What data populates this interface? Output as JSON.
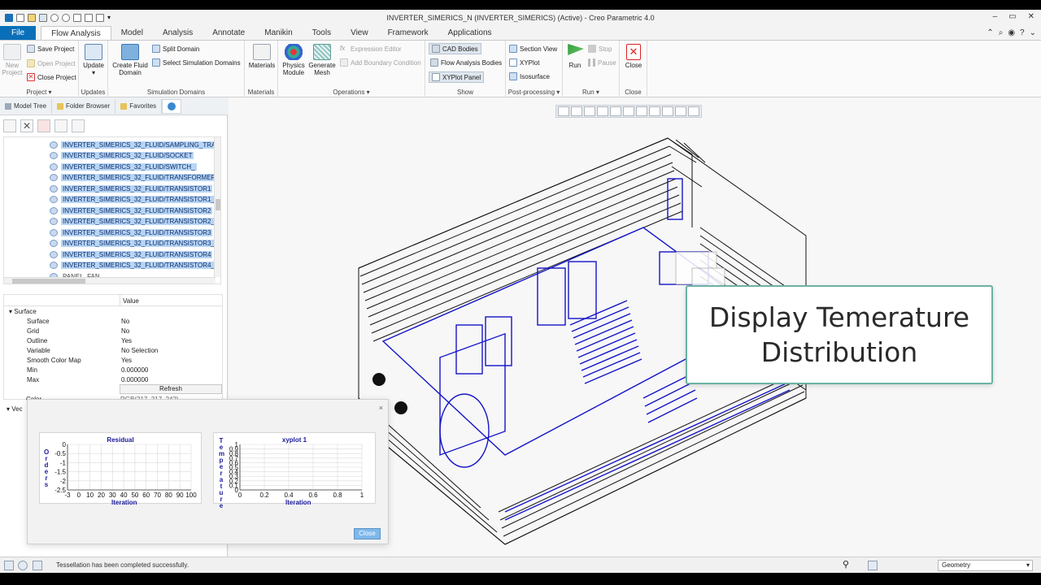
{
  "window": {
    "title": "INVERTER_SIMERICS_N (INVERTER_SIMERICS) (Active) - Creo Parametric 4.0",
    "controls": [
      "–",
      "▭",
      "✕"
    ]
  },
  "ribbon_tabs": [
    {
      "label": "File"
    },
    {
      "label": "Flow Analysis"
    },
    {
      "label": "Model"
    },
    {
      "label": "Analysis"
    },
    {
      "label": "Annotate"
    },
    {
      "label": "Manikin"
    },
    {
      "label": "Tools"
    },
    {
      "label": "View"
    },
    {
      "label": "Framework"
    },
    {
      "label": "Applications"
    }
  ],
  "ribbon": {
    "project": {
      "group_label": "Project ▾",
      "new_project": "New\nProject",
      "save_project": "Save Project",
      "open_project": "Open Project",
      "close_project": "Close Project"
    },
    "updates": {
      "group_label": "Updates",
      "update": "Update ▾"
    },
    "simulation_domains": {
      "group_label": "Simulation Domains",
      "create_fluid_domain": "Create Fluid\nDomain",
      "split_domain": "Split Domain",
      "select_simulation_domains": "Select Simulation Domains"
    },
    "materials": {
      "group_label": "Materials",
      "materials": "Materials"
    },
    "operations": {
      "group_label": "Operations ▾",
      "physics_module": "Physics\nModule",
      "generate_mesh": "Generate\nMesh",
      "expression_editor": "Expression Editor",
      "add_boundary_condition": "Add Boundary Condition"
    },
    "show": {
      "group_label": "Show",
      "cad_bodies": "CAD Bodies",
      "flow_analysis_bodies": "Flow Analysis Bodies",
      "xyplot_panel": "XYPlot Panel"
    },
    "post_processing": {
      "group_label": "Post-processing ▾",
      "section_view": "Section View",
      "xyplot": "XYPlot",
      "isosurface": "Isosurface"
    },
    "run": {
      "group_label": "Run ▾",
      "run": "Run",
      "stop": "Stop",
      "pause": "Pause"
    },
    "close": {
      "group_label": "Close",
      "close": "Close"
    }
  },
  "nav_tabs": [
    {
      "label": "Model Tree"
    },
    {
      "label": "Folder Browser"
    },
    {
      "label": "Favorites"
    }
  ],
  "tree_items": [
    {
      "label": "INVERTER_SIMERICS_32_FLUID/SAMPLING_TRANSFO",
      "selected": true
    },
    {
      "label": "INVERTER_SIMERICS_32_FLUID/SOCKET",
      "selected": true
    },
    {
      "label": "INVERTER_SIMERICS_32_FLUID/SWITCH_",
      "selected": true
    },
    {
      "label": "INVERTER_SIMERICS_32_FLUID/TRANSFORMER",
      "selected": true
    },
    {
      "label": "INVERTER_SIMERICS_32_FLUID/TRANSISTOR1",
      "selected": true
    },
    {
      "label": "INVERTER_SIMERICS_32_FLUID/TRANSISTOR1_1",
      "selected": true
    },
    {
      "label": "INVERTER_SIMERICS_32_FLUID/TRANSISTOR2",
      "selected": true
    },
    {
      "label": "INVERTER_SIMERICS_32_FLUID/TRANSISTOR2_1",
      "selected": true
    },
    {
      "label": "INVERTER_SIMERICS_32_FLUID/TRANSISTOR3",
      "selected": true
    },
    {
      "label": "INVERTER_SIMERICS_32_FLUID/TRANSISTOR3_1",
      "selected": true
    },
    {
      "label": "INVERTER_SIMERICS_32_FLUID/TRANSISTOR4",
      "selected": true
    },
    {
      "label": "INVERTER_SIMERICS_32_FLUID/TRANSISTOR4_1",
      "selected": true
    },
    {
      "label": "PANEL_FAN_",
      "selected": false
    }
  ],
  "properties": {
    "value_header": "Value",
    "section_surface": "Surface",
    "rows": [
      {
        "key": "Surface",
        "value": "No"
      },
      {
        "key": "Grid",
        "value": "No"
      },
      {
        "key": "Outline",
        "value": "Yes"
      },
      {
        "key": "Variable",
        "value": "No Selection"
      },
      {
        "key": "Smooth Color Map",
        "value": "Yes"
      },
      {
        "key": "Min",
        "value": "0.000000"
      },
      {
        "key": "Max",
        "value": "0.000000"
      }
    ],
    "refresh": "Refresh",
    "color_key": "Color",
    "color_value": "RGB(217, 217, 242)",
    "section_vec": "Vec"
  },
  "callout": {
    "text": "Display Temerature\nDistribution",
    "border_color": "#6bb3a3"
  },
  "dialog": {
    "close_label": "Close",
    "close_x": "×"
  },
  "chart_data": [
    {
      "type": "line",
      "title": "Residual",
      "xlabel": "Iteration",
      "ylabel": "Orders",
      "x_ticks": [
        "-3",
        "0",
        "10",
        "20",
        "30",
        "40",
        "50",
        "60",
        "70",
        "80",
        "90",
        "100"
      ],
      "y_ticks": [
        "0",
        "-0.5",
        "-1",
        "-1.5",
        "-2",
        "-2.5"
      ],
      "xlim": [
        0,
        100
      ],
      "ylim": [
        -3,
        0
      ],
      "series": [],
      "grid": true
    },
    {
      "type": "line",
      "title": "xyplot 1",
      "xlabel": "Iteration",
      "ylabel": "Temperature",
      "x_ticks": [
        "0",
        "0.2",
        "0.4",
        "0.6",
        "0.8",
        "1"
      ],
      "y_ticks": [
        "1",
        "0.9",
        "0.8",
        "0.7",
        "0.6",
        "0.5",
        "0.4",
        "0.3",
        "0.2",
        "0.1",
        "0"
      ],
      "xlim": [
        0,
        1
      ],
      "ylim": [
        0,
        1
      ],
      "series": [],
      "grid": true
    }
  ],
  "status": {
    "message": "Tessellation has been completed successfully.",
    "filter_value": "Geometry"
  }
}
